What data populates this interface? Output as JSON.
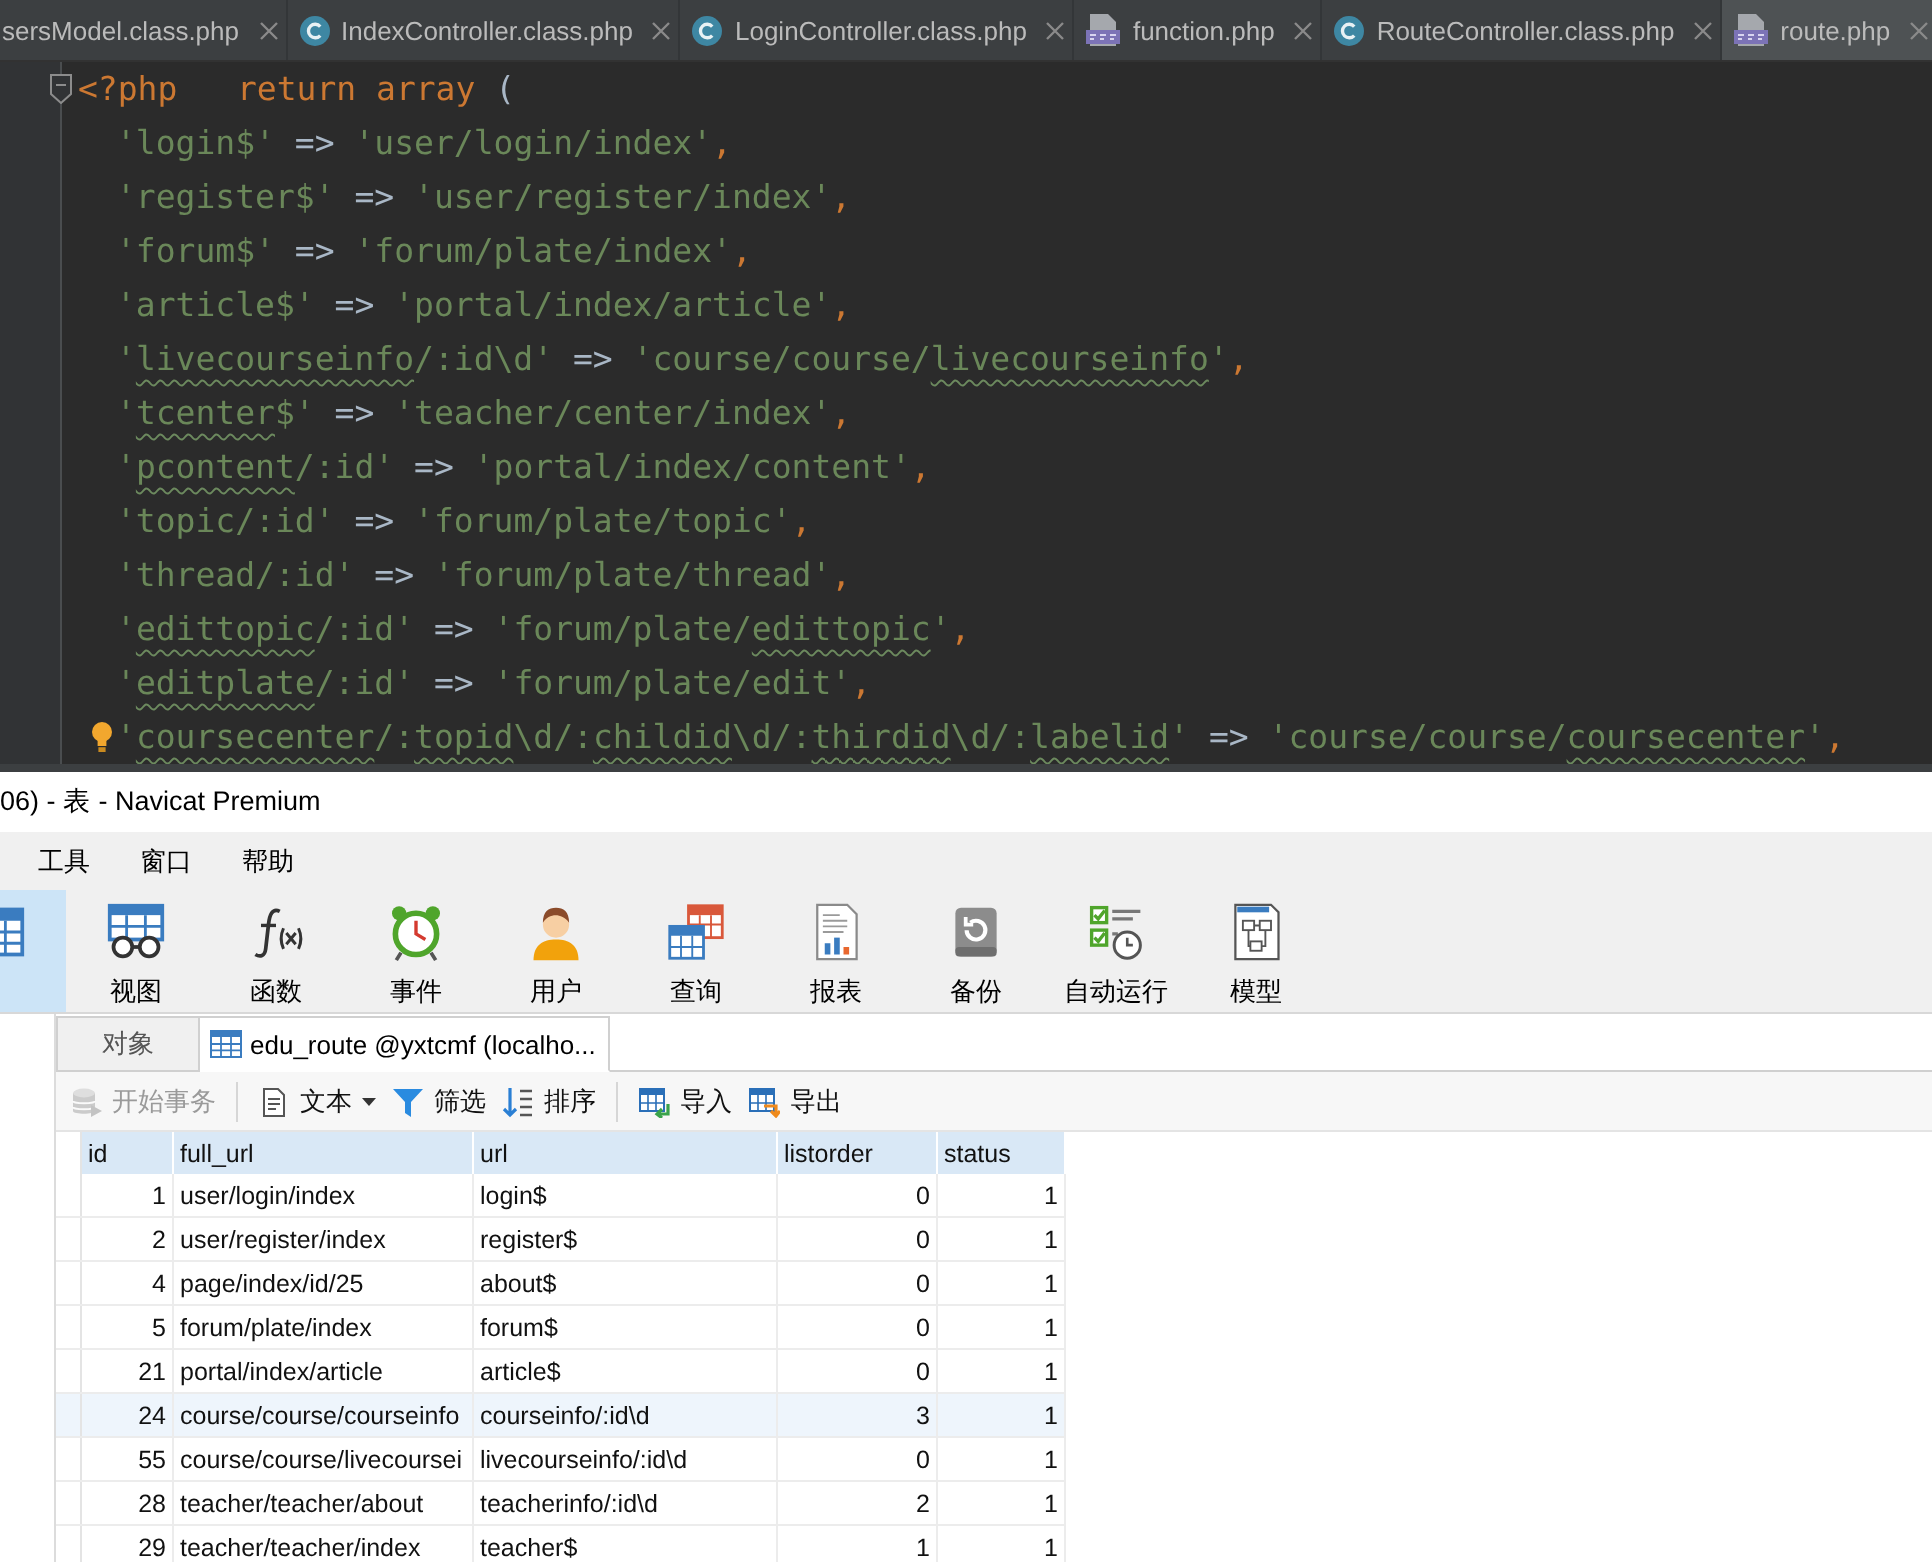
{
  "editor": {
    "tabs": [
      {
        "label": "sersModel.class.php",
        "selected": false
      },
      {
        "label": "IndexController.class.php",
        "kind": "class",
        "selected": false
      },
      {
        "label": "LoginController.class.php",
        "kind": "class",
        "selected": false
      },
      {
        "label": "function.php",
        "kind": "php",
        "selected": false
      },
      {
        "label": "RouteController.class.php",
        "kind": "class",
        "selected": false
      },
      {
        "label": "route.php",
        "kind": "php",
        "selected": true
      }
    ],
    "lines": [
      {
        "kind": "open",
        "fold_marker": true,
        "bulb": false,
        "tokens": [
          {
            "text": "<?php   return array ",
            "kind": "keyword"
          },
          {
            "text": "(",
            "kind": "plain"
          }
        ]
      },
      {
        "kind": "entry",
        "fold_marker": false,
        "bulb": false,
        "tokens": [
          {
            "text": "'login$'",
            "kind": "string"
          },
          {
            "text": " => ",
            "kind": "plain"
          },
          {
            "text": "'user/login/index'",
            "kind": "string"
          },
          {
            "text": ",",
            "kind": "punct"
          }
        ]
      },
      {
        "kind": "entry",
        "fold_marker": false,
        "bulb": false,
        "tokens": [
          {
            "text": "'register$'",
            "kind": "string"
          },
          {
            "text": " => ",
            "kind": "plain"
          },
          {
            "text": "'user/register/index'",
            "kind": "string"
          },
          {
            "text": ",",
            "kind": "punct"
          }
        ]
      },
      {
        "kind": "entry",
        "fold_marker": false,
        "bulb": false,
        "tokens": [
          {
            "text": "'forum$'",
            "kind": "string"
          },
          {
            "text": " => ",
            "kind": "plain"
          },
          {
            "text": "'forum/plate/index'",
            "kind": "string"
          },
          {
            "text": ",",
            "kind": "punct"
          }
        ]
      },
      {
        "kind": "entry",
        "fold_marker": false,
        "bulb": false,
        "tokens": [
          {
            "text": "'article$'",
            "kind": "string"
          },
          {
            "text": " => ",
            "kind": "plain"
          },
          {
            "text": "'portal/index/article'",
            "kind": "string"
          },
          {
            "text": ",",
            "kind": "punct"
          }
        ]
      },
      {
        "kind": "entry",
        "fold_marker": false,
        "bulb": false,
        "tokens": [
          {
            "text": "'",
            "kind": "string"
          },
          {
            "text": "livecourseinfo",
            "kind": "misspelt"
          },
          {
            "text": "/:id\\d'",
            "kind": "string"
          },
          {
            "text": " => ",
            "kind": "plain"
          },
          {
            "text": "'course/course/",
            "kind": "string"
          },
          {
            "text": "livecourseinfo",
            "kind": "misspelt"
          },
          {
            "text": "'",
            "kind": "string"
          },
          {
            "text": ",",
            "kind": "punct"
          }
        ]
      },
      {
        "kind": "entry",
        "fold_marker": false,
        "bulb": false,
        "tokens": [
          {
            "text": "'",
            "kind": "string"
          },
          {
            "text": "tcenter",
            "kind": "misspelt"
          },
          {
            "text": "$'",
            "kind": "string"
          },
          {
            "text": " => ",
            "kind": "plain"
          },
          {
            "text": "'teacher/center/index'",
            "kind": "string"
          },
          {
            "text": ",",
            "kind": "punct"
          }
        ]
      },
      {
        "kind": "entry",
        "fold_marker": false,
        "bulb": false,
        "tokens": [
          {
            "text": "'",
            "kind": "string"
          },
          {
            "text": "pcontent",
            "kind": "misspelt"
          },
          {
            "text": "/:id'",
            "kind": "string"
          },
          {
            "text": " => ",
            "kind": "plain"
          },
          {
            "text": "'portal/index/content'",
            "kind": "string"
          },
          {
            "text": ",",
            "kind": "punct"
          }
        ]
      },
      {
        "kind": "entry",
        "fold_marker": false,
        "bulb": false,
        "tokens": [
          {
            "text": "'topic/:id'",
            "kind": "string"
          },
          {
            "text": " => ",
            "kind": "plain"
          },
          {
            "text": "'forum/plate/topic'",
            "kind": "string"
          },
          {
            "text": ",",
            "kind": "punct"
          }
        ]
      },
      {
        "kind": "entry",
        "fold_marker": false,
        "bulb": false,
        "tokens": [
          {
            "text": "'thread/:id'",
            "kind": "string"
          },
          {
            "text": " => ",
            "kind": "plain"
          },
          {
            "text": "'forum/plate/thread'",
            "kind": "string"
          },
          {
            "text": ",",
            "kind": "punct"
          }
        ]
      },
      {
        "kind": "entry",
        "fold_marker": false,
        "bulb": false,
        "tokens": [
          {
            "text": "'",
            "kind": "string"
          },
          {
            "text": "edittopic",
            "kind": "misspelt"
          },
          {
            "text": "/:id'",
            "kind": "string"
          },
          {
            "text": " => ",
            "kind": "plain"
          },
          {
            "text": "'forum/plate/",
            "kind": "string"
          },
          {
            "text": "edittopic",
            "kind": "misspelt"
          },
          {
            "text": "'",
            "kind": "string"
          },
          {
            "text": ",",
            "kind": "punct"
          }
        ]
      },
      {
        "kind": "entry",
        "fold_marker": false,
        "bulb": false,
        "tokens": [
          {
            "text": "'",
            "kind": "string"
          },
          {
            "text": "editplate",
            "kind": "misspelt"
          },
          {
            "text": "/:id'",
            "kind": "string"
          },
          {
            "text": " => ",
            "kind": "plain"
          },
          {
            "text": "'forum/plate/edit'",
            "kind": "string"
          },
          {
            "text": ",",
            "kind": "punct"
          }
        ]
      },
      {
        "kind": "entry",
        "fold_marker": false,
        "bulb": true,
        "tokens": [
          {
            "text": "'",
            "kind": "string"
          },
          {
            "text": "coursecenter",
            "kind": "misspelt"
          },
          {
            "text": "/:",
            "kind": "string"
          },
          {
            "text": "topid",
            "kind": "misspelt"
          },
          {
            "text": "\\d/:",
            "kind": "string"
          },
          {
            "text": "childid",
            "kind": "misspelt"
          },
          {
            "text": "\\d/:",
            "kind": "string"
          },
          {
            "text": "thirdid",
            "kind": "misspelt"
          },
          {
            "text": "\\d/:",
            "kind": "string"
          },
          {
            "text": "labelid",
            "kind": "misspelt"
          },
          {
            "text": "'",
            "kind": "string"
          },
          {
            "text": " => ",
            "kind": "plain"
          },
          {
            "text": "'course/course/",
            "kind": "string"
          },
          {
            "text": "coursecenter",
            "kind": "misspelt"
          },
          {
            "text": "'",
            "kind": "string"
          },
          {
            "text": ",",
            "kind": "punct"
          }
        ]
      }
    ]
  },
  "navicat": {
    "window": {
      "title": "06) - 表 - Navicat Premium"
    },
    "menu": [
      "工具",
      "窗口",
      "帮助"
    ],
    "toolbar": [
      {
        "kind": "table",
        "selected": true
      },
      {
        "kind": "view",
        "label": "视图",
        "selected": false
      },
      {
        "kind": "function",
        "label": "函数",
        "selected": false
      },
      {
        "kind": "event",
        "label": "事件",
        "selected": false
      },
      {
        "kind": "user",
        "label": "用户",
        "selected": false
      },
      {
        "kind": "query",
        "label": "查询",
        "selected": false
      },
      {
        "kind": "report",
        "label": "报表",
        "selected": false
      },
      {
        "kind": "backup",
        "label": "备份",
        "selected": false
      },
      {
        "kind": "automation",
        "label": "自动运行",
        "selected": false
      },
      {
        "kind": "model",
        "label": "模型",
        "selected": false
      }
    ],
    "object_tabs": [
      {
        "label": "对象",
        "selected": false
      },
      {
        "kind": "table",
        "label": "edu_route @yxtcmf (localho...",
        "selected": true
      }
    ],
    "action_groups": [
      [
        {
          "kind": "transaction",
          "label": "开始事务",
          "disabled": true,
          "dropdown": false
        }
      ],
      [
        {
          "kind": "text",
          "label": "文本",
          "disabled": false,
          "dropdown": true
        },
        {
          "kind": "filter",
          "label": "筛选",
          "disabled": false,
          "dropdown": false
        },
        {
          "kind": "sort",
          "label": "排序",
          "disabled": false,
          "dropdown": false
        }
      ],
      [
        {
          "kind": "import",
          "label": "导入",
          "disabled": false,
          "dropdown": false
        },
        {
          "kind": "export",
          "label": "导出",
          "disabled": false,
          "dropdown": false
        }
      ]
    ],
    "table": {
      "columns": [
        {
          "label": "id",
          "kind": "number"
        },
        {
          "label": "full_url",
          "kind": "text"
        },
        {
          "label": "url",
          "kind": "text"
        },
        {
          "label": "listorder",
          "kind": "number"
        },
        {
          "label": "status",
          "kind": "number"
        }
      ],
      "rows": [
        {
          "cells": [
            "1",
            "user/login/index",
            "login$",
            "0",
            "1"
          ],
          "selected": false
        },
        {
          "cells": [
            "2",
            "user/register/index",
            "register$",
            "0",
            "1"
          ],
          "selected": false
        },
        {
          "cells": [
            "4",
            "page/index/id/25",
            "about$",
            "0",
            "1"
          ],
          "selected": false
        },
        {
          "cells": [
            "5",
            "forum/plate/index",
            "forum$",
            "0",
            "1"
          ],
          "selected": false
        },
        {
          "cells": [
            "21",
            "portal/index/article",
            "article$",
            "0",
            "1"
          ],
          "selected": false
        },
        {
          "cells": [
            "24",
            "course/course/courseinfo",
            "courseinfo/:id\\d",
            "3",
            "1"
          ],
          "selected": true
        },
        {
          "cells": [
            "55",
            "course/course/livecoursei",
            "livecourseinfo/:id\\d",
            "0",
            "1"
          ],
          "selected": false
        },
        {
          "cells": [
            "28",
            "teacher/teacher/about",
            "teacherinfo/:id\\d",
            "2",
            "1"
          ],
          "selected": false
        },
        {
          "cells": [
            "29",
            "teacher/teacher/index",
            "teacher$",
            "1",
            "1"
          ],
          "selected": false
        }
      ]
    }
  }
}
